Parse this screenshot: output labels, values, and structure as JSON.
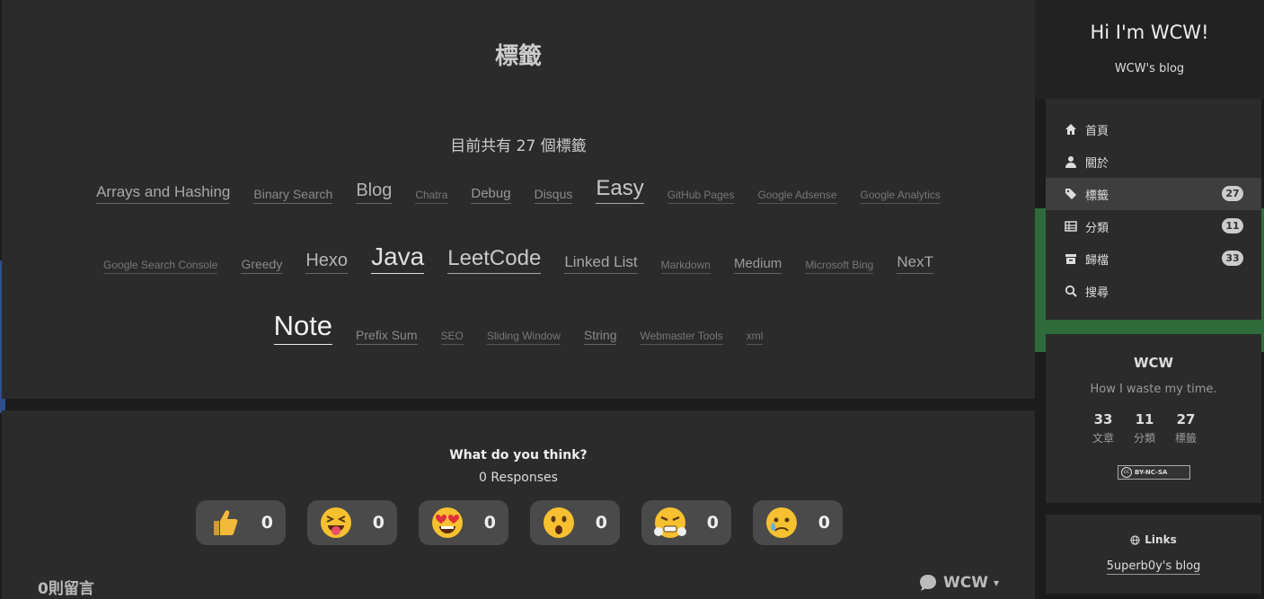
{
  "page": {
    "title": "標籤",
    "tag_count_text": "目前共有 27 個標籤"
  },
  "tag_rows": [
    [
      {
        "label": "Arrays and Hashing",
        "size": 4
      },
      {
        "label": "Binary Search",
        "size": 2
      },
      {
        "label": "Blog",
        "size": 5
      },
      {
        "label": "Chatra",
        "size": 1
      },
      {
        "label": "Debug",
        "size": 3
      },
      {
        "label": "Disqus",
        "size": 2
      },
      {
        "label": "Easy",
        "size": 6
      },
      {
        "label": "GitHub Pages",
        "size": 1
      },
      {
        "label": "Google Adsense",
        "size": 1
      },
      {
        "label": "Google Analytics",
        "size": 1
      }
    ],
    [
      {
        "label": "Google Search Console",
        "size": 1
      },
      {
        "label": "Greedy",
        "size": 2
      },
      {
        "label": "Hexo",
        "size": 5
      },
      {
        "label": "Java",
        "size": 7
      },
      {
        "label": "LeetCode",
        "size": 6
      },
      {
        "label": "Linked List",
        "size": 4
      },
      {
        "label": "Markdown",
        "size": 1
      },
      {
        "label": "Medium",
        "size": 3
      },
      {
        "label": "Microsoft Bing",
        "size": 1
      },
      {
        "label": "NexT",
        "size": 4
      }
    ],
    [
      {
        "label": "Note",
        "size": 8
      },
      {
        "label": "Prefix Sum",
        "size": 2
      },
      {
        "label": "SEO",
        "size": 1
      },
      {
        "label": "Sliding Window",
        "size": 1
      },
      {
        "label": "String",
        "size": 2
      },
      {
        "label": "Webmaster Tools",
        "size": 1
      },
      {
        "label": "xml",
        "size": 1
      }
    ]
  ],
  "comments": {
    "question": "What do you think?",
    "responses": "0 Responses",
    "reactions": [
      {
        "icon": "thumbs-up",
        "count": "0"
      },
      {
        "icon": "laughing-tongue",
        "count": "0"
      },
      {
        "icon": "heart-eyes",
        "count": "0"
      },
      {
        "icon": "surprised",
        "count": "0"
      },
      {
        "icon": "angry",
        "count": "0"
      },
      {
        "icon": "sad",
        "count": "0"
      }
    ],
    "count_label": "0則留言",
    "login_label": "WCW"
  },
  "sidebar": {
    "brand_title": "Hi I'm WCW!",
    "brand_subtitle": "WCW's blog",
    "menu": [
      {
        "icon": "home-icon",
        "label": "首頁",
        "badge": null,
        "active": false
      },
      {
        "icon": "user-icon",
        "label": "關於",
        "badge": null,
        "active": false
      },
      {
        "icon": "tags-icon",
        "label": "標籤",
        "badge": "27",
        "active": true
      },
      {
        "icon": "grid-icon",
        "label": "分類",
        "badge": "11",
        "active": false
      },
      {
        "icon": "archive-icon",
        "label": "歸檔",
        "badge": "33",
        "active": false
      },
      {
        "icon": "search-icon",
        "label": "搜尋",
        "badge": null,
        "active": false
      }
    ],
    "author": {
      "name": "WCW",
      "description": "How I waste my time.",
      "stats": [
        {
          "num": "33",
          "label": "文章"
        },
        {
          "num": "11",
          "label": "分類"
        },
        {
          "num": "27",
          "label": "標籤"
        }
      ],
      "license": "BY-NC-SA",
      "license_mark": "cc"
    },
    "links": {
      "title": "Links",
      "items": [
        "5uperb0y's blog"
      ]
    }
  }
}
